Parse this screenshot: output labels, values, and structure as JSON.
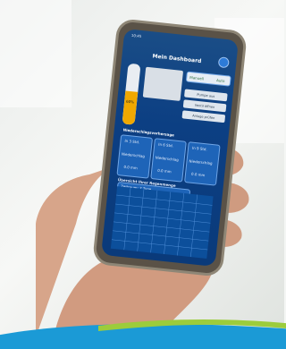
{
  "dashboard": {
    "title": "Mein Dashboard",
    "status_left": "10:45",
    "tank_label": "60%",
    "toggle": {
      "left": "Manuell",
      "right": "Auto"
    },
    "buttons": [
      "Pumpe aus",
      "Ventil öffnen",
      "Anlage prüfen"
    ],
    "section_title": "Niederschlagsvorhersage",
    "forecast": [
      {
        "time": "In 3 Std.",
        "label": "Niederschlag",
        "value": "0.0 mm"
      },
      {
        "time": "In 6 Std.",
        "label": "Niederschlag",
        "value": "0.0 mm"
      },
      {
        "time": "In 9 Std.",
        "label": "Niederschlag",
        "value": "0.0 mm"
      }
    ],
    "chart_section_title": "Übersicht Ihrer Regenmenge",
    "chart_filter": "Zeitraum: 7 Tage"
  },
  "colors": {
    "screen": "#0c3f83",
    "accent": "#1e64b8",
    "tank": "#f0a800"
  }
}
